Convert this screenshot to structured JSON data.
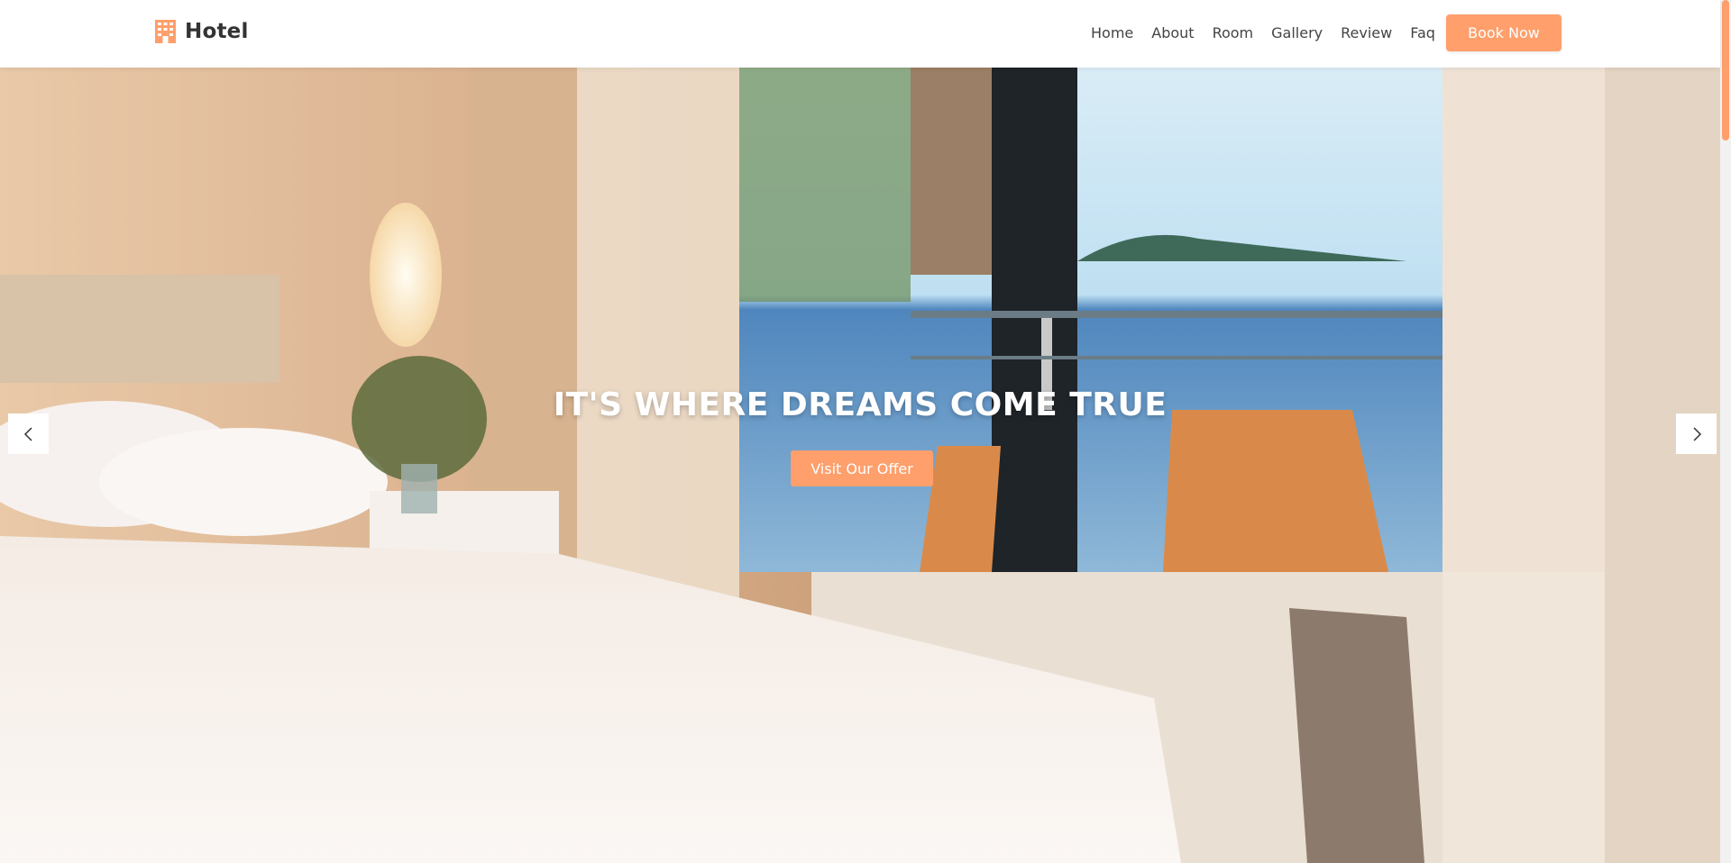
{
  "header": {
    "brand": "Hotel",
    "brand_icon": "hotel-building-icon",
    "nav": [
      {
        "label": "Home"
      },
      {
        "label": "About"
      },
      {
        "label": "Room"
      },
      {
        "label": "Gallery"
      },
      {
        "label": "Review"
      },
      {
        "label": "Faq"
      }
    ],
    "book_label": "Book Now"
  },
  "hero": {
    "title": "IT'S WHERE DREAMS COME TRUE",
    "cta_label": "Visit Our Offer",
    "prev_icon": "chevron-left-icon",
    "next_icon": "chevron-right-icon"
  },
  "colors": {
    "accent": "#fe9f6c",
    "text_dark": "#333333",
    "white": "#ffffff"
  }
}
